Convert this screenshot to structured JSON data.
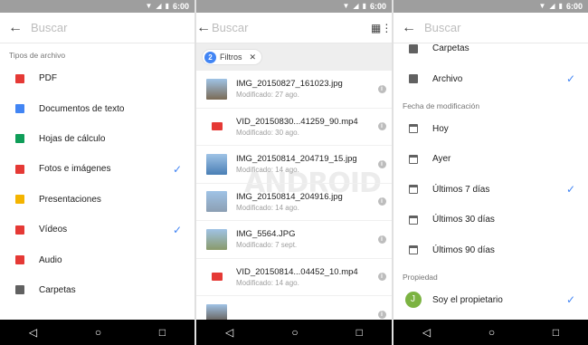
{
  "status": {
    "time": "6:00"
  },
  "search": {
    "placeholder": "Buscar"
  },
  "panel1": {
    "section": "Tipos de archivo",
    "items": [
      {
        "label": "PDF",
        "icon": "pdf-icon",
        "color": "#e53935",
        "checked": false
      },
      {
        "label": "Documentos de texto",
        "icon": "doc-icon",
        "color": "#4285f4",
        "checked": false
      },
      {
        "label": "Hojas de cálculo",
        "icon": "sheet-icon",
        "color": "#0f9d58",
        "checked": false
      },
      {
        "label": "Fotos e imágenes",
        "icon": "image-icon",
        "color": "#e53935",
        "checked": true
      },
      {
        "label": "Presentaciones",
        "icon": "slides-icon",
        "color": "#f4b400",
        "checked": false
      },
      {
        "label": "Vídeos",
        "icon": "video-icon",
        "color": "#e53935",
        "checked": true
      },
      {
        "label": "Audio",
        "icon": "audio-icon",
        "color": "#e53935",
        "checked": false
      },
      {
        "label": "Carpetas",
        "icon": "folder-icon",
        "color": "#616161",
        "checked": false
      }
    ]
  },
  "panel2": {
    "filter_count": "2",
    "filter_label": "Filtros",
    "watermark": "ANDROID",
    "files": [
      {
        "name": "IMG_20150827_161023.jpg",
        "meta": "Modificado: 27 ago.",
        "type": "image",
        "color": "#7a6a55"
      },
      {
        "name": "VID_20150830...41259_90.mp4",
        "meta": "Modificado: 30 ago.",
        "type": "video",
        "color": "#e53935"
      },
      {
        "name": "IMG_20150814_204719_15.jpg",
        "meta": "Modificado: 14 ago.",
        "type": "image",
        "color": "#4a7fb5"
      },
      {
        "name": "IMG_20150814_204916.jpg",
        "meta": "Modificado: 14 ago.",
        "type": "image",
        "color": "#8c9fb3"
      },
      {
        "name": "IMG_5564.JPG",
        "meta": "Modificado: 7 sept.",
        "type": "image",
        "color": "#8a9a6a"
      },
      {
        "name": "VID_20150814...04452_10.mp4",
        "meta": "Modificado: 14 ago.",
        "type": "video",
        "color": "#e53935"
      },
      {
        "name": "",
        "meta": "",
        "type": "image",
        "color": "#5a4a3a"
      }
    ]
  },
  "panel3": {
    "top_items": [
      {
        "label": "Carpetas",
        "icon": "folder-icon",
        "checked": false
      },
      {
        "label": "Archivo",
        "icon": "archive-icon",
        "checked": true
      }
    ],
    "date_section": "Fecha de modificación",
    "dates": [
      {
        "label": "Hoy",
        "checked": false
      },
      {
        "label": "Ayer",
        "checked": false
      },
      {
        "label": "Últimos 7 días",
        "checked": true
      },
      {
        "label": "Últimos 30 días",
        "checked": false
      },
      {
        "label": "Últimos 90 días",
        "checked": false
      }
    ],
    "owner_section": "Propiedad",
    "owner": {
      "label": "Soy el propietario",
      "avatar": "J",
      "checked": true
    }
  }
}
